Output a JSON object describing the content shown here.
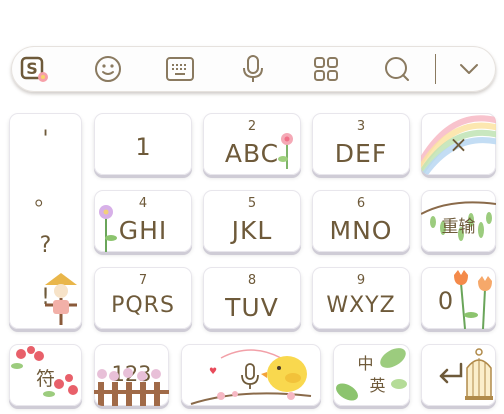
{
  "toolbar": {
    "icons": [
      "sogou-logo-icon",
      "emoji-icon",
      "keyboard-icon",
      "microphone-icon",
      "grid-apps-icon",
      "search-icon",
      "collapse-chevron-icon"
    ],
    "accent_color": "#8a7a60"
  },
  "symbol_column": {
    "items": [
      "'",
      "。",
      "?",
      "!"
    ]
  },
  "keys": {
    "k1": {
      "main": "1"
    },
    "abc": {
      "sub": "2",
      "main": "ABC"
    },
    "def": {
      "sub": "3",
      "main": "DEF"
    },
    "del": {
      "icon": "delete-x-icon",
      "main": "×"
    },
    "ghi": {
      "sub": "4",
      "main": "GHI"
    },
    "jkl": {
      "sub": "5",
      "main": "JKL"
    },
    "mno": {
      "sub": "6",
      "main": "MNO"
    },
    "retype": {
      "main": "重输"
    },
    "pqrs": {
      "sub": "7",
      "main": "PQRS"
    },
    "tuv": {
      "sub": "8",
      "main": "TUV"
    },
    "wxyz": {
      "sub": "9",
      "main": "WXYZ"
    },
    "zero": {
      "main": "0"
    },
    "fu": {
      "main": "符"
    },
    "num": {
      "main": "123"
    },
    "lang": {
      "top": "中",
      "bottom": "英"
    },
    "enter": {
      "icon": "enter-arrow-icon"
    }
  },
  "colors": {
    "key_text": "#6e5a3a",
    "key_bg": "#ffffff",
    "key_shadow": "#cfccd6"
  }
}
